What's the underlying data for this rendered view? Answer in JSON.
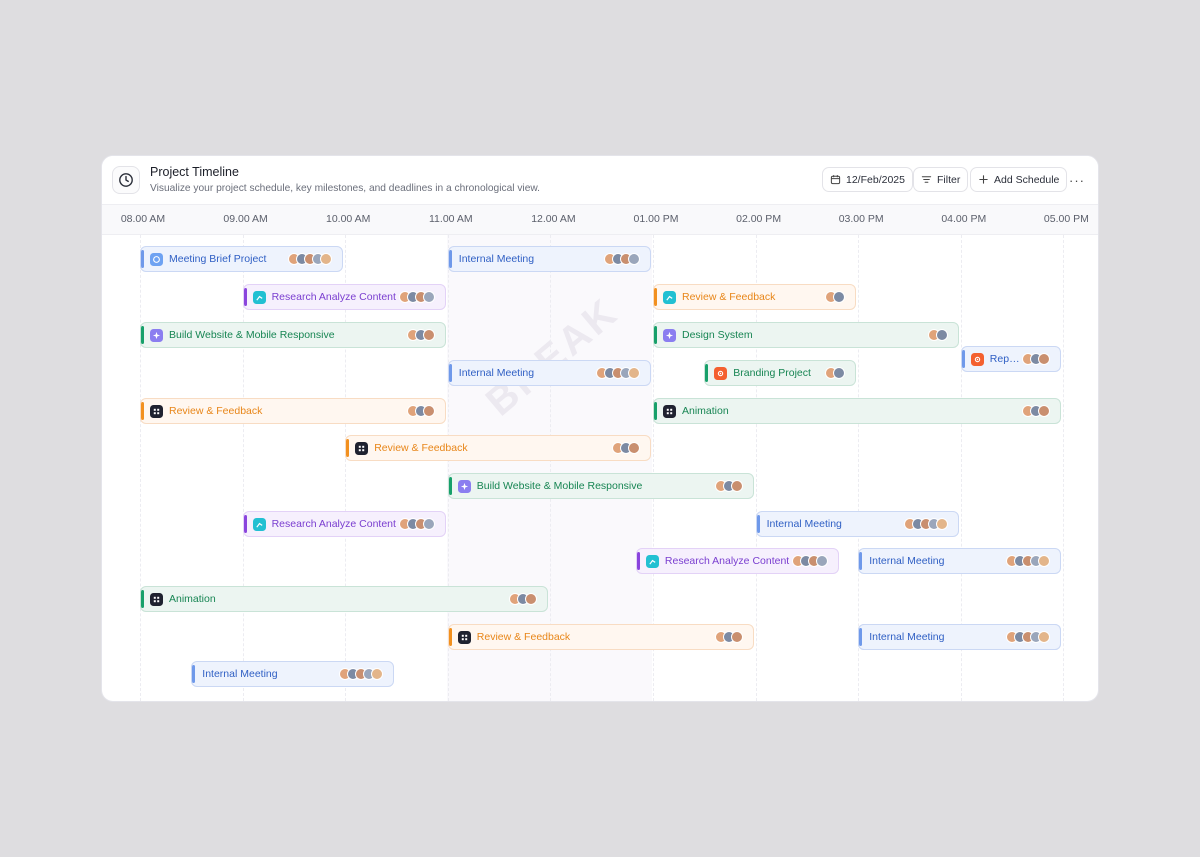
{
  "header": {
    "title": "Project Timeline",
    "subtitle": "Visualize your project schedule, key milestones, and deadlines in a chronological view.",
    "date_label": "12/Feb/2025",
    "filter_label": "Filter",
    "add_label": "Add Schedule",
    "more_label": "···",
    "icon": "clock-icon"
  },
  "time_labels": [
    "08.00 AM",
    "09.00 AM",
    "10.00 AM",
    "11.00 AM",
    "12.00 AM",
    "01.00 PM",
    "02.00 PM",
    "03.00 PM",
    "04.00 PM",
    "05.00 PM"
  ],
  "break_label": "BREAK",
  "colors": {
    "blue": "#2f5fc4",
    "purple": "#7a3ed0",
    "green": "#178553",
    "orange": "#e88619"
  },
  "tasks": [
    {
      "label": "Meeting Brief Project",
      "start": "08.00 AM",
      "end": "10.00 AM",
      "color": "blue",
      "icon": "calendar-icon",
      "avatars": 5
    },
    {
      "label": "Internal Meeting",
      "start": "11.00 AM",
      "end": "01.00 PM",
      "color": "blue",
      "icon": "",
      "avatars": 4
    },
    {
      "label": "Research Analyze Content",
      "start": "09.00 AM",
      "end": "11.00 AM",
      "color": "purple",
      "icon": "chart-icon",
      "avatars": 4
    },
    {
      "label": "Review & Feedback",
      "start": "01.00 PM",
      "end": "03.00 PM",
      "color": "orange",
      "icon": "chart-icon",
      "avatars": 2
    },
    {
      "label": "Build Website & Mobile Responsive",
      "start": "08.00 AM",
      "end": "11.00 AM",
      "color": "green",
      "icon": "sparkle-icon",
      "avatars": 3
    },
    {
      "label": "Design System",
      "start": "01.00 PM",
      "end": "04.00 PM",
      "color": "green",
      "icon": "sparkle-icon",
      "avatars": 2
    },
    {
      "label": "Repor...",
      "start": "04.00 PM",
      "end": "05.00 PM",
      "color": "blue",
      "icon": "flower-icon",
      "avatars": 3
    },
    {
      "label": "Internal Meeting",
      "start": "11.00 AM",
      "end": "01.00 PM",
      "color": "blue",
      "icon": "",
      "avatars": 5
    },
    {
      "label": "Branding Project",
      "start": "01.30 PM",
      "end": "03.00 PM",
      "color": "green",
      "icon": "flower-icon",
      "avatars": 2
    },
    {
      "label": "Review & Feedback",
      "start": "08.00 AM",
      "end": "11.00 AM",
      "color": "orange",
      "icon": "grid-icon",
      "avatars": 3
    },
    {
      "label": "Animation",
      "start": "01.00 PM",
      "end": "05.00 PM",
      "color": "green",
      "icon": "grid-icon",
      "avatars": 3
    },
    {
      "label": "Review & Feedback",
      "start": "10.00 AM",
      "end": "01.00 PM",
      "color": "orange",
      "icon": "grid-icon",
      "avatars": 3
    },
    {
      "label": "Build Website & Mobile Responsive",
      "start": "11.00 AM",
      "end": "02.00 PM",
      "color": "green",
      "icon": "sparkle-icon",
      "avatars": 3
    },
    {
      "label": "Research Analyze Content",
      "start": "09.00 AM",
      "end": "11.00 AM",
      "color": "purple",
      "icon": "chart-icon",
      "avatars": 4
    },
    {
      "label": "Internal Meeting",
      "start": "02.00 PM",
      "end": "04.00 PM",
      "color": "blue",
      "icon": "",
      "avatars": 5
    },
    {
      "label": "Research Analyze Content",
      "start": "12.50 PM",
      "end": "02.50 PM",
      "color": "purple",
      "icon": "chart-icon",
      "avatars": 4
    },
    {
      "label": "Internal Meeting",
      "start": "03.00 PM",
      "end": "05.00 PM",
      "color": "blue",
      "icon": "",
      "avatars": 5
    },
    {
      "label": "Animation",
      "start": "08.00 AM",
      "end": "12.00 AM",
      "color": "green",
      "icon": "grid-icon",
      "avatars": 3
    },
    {
      "label": "Internal Meeting",
      "start": "03.00 PM",
      "end": "05.00 PM",
      "color": "blue",
      "icon": "",
      "avatars": 5
    },
    {
      "label": "Review & Feedback",
      "start": "11.00 AM",
      "end": "02.00 PM",
      "color": "orange",
      "icon": "grid-icon",
      "avatars": 3
    },
    {
      "label": "Internal Meeting",
      "start": "03.00 PM",
      "end": "05.00 PM",
      "color": "blue",
      "icon": "",
      "avatars": 5
    },
    {
      "label": "Internal Meeting",
      "start": "08.30 AM",
      "end": "10.30 AM",
      "color": "blue",
      "icon": "",
      "avatars": 5
    }
  ]
}
